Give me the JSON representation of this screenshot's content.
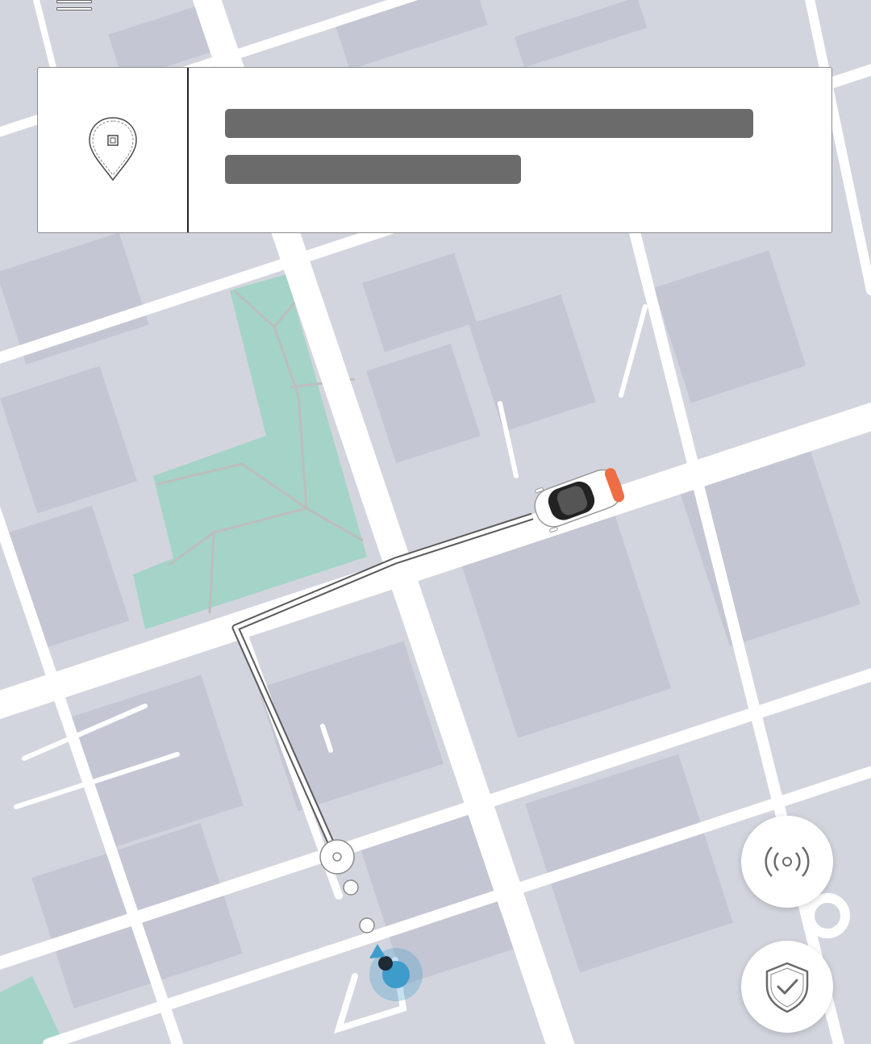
{
  "map": {
    "colors": {
      "background": "#d3d5de",
      "block": "#c3c5d2",
      "park": "#a3d4c7",
      "road": "#ffffff",
      "route": "#ffffff",
      "user_location": "#3e9ccb"
    }
  },
  "header": {
    "menu_icon": "hamburger-icon"
  },
  "destination_card": {
    "icon": "location-pin-icon",
    "loading": true
  },
  "actions": {
    "broadcast_icon": "broadcast-icon",
    "safety_icon": "shield-check-icon"
  }
}
